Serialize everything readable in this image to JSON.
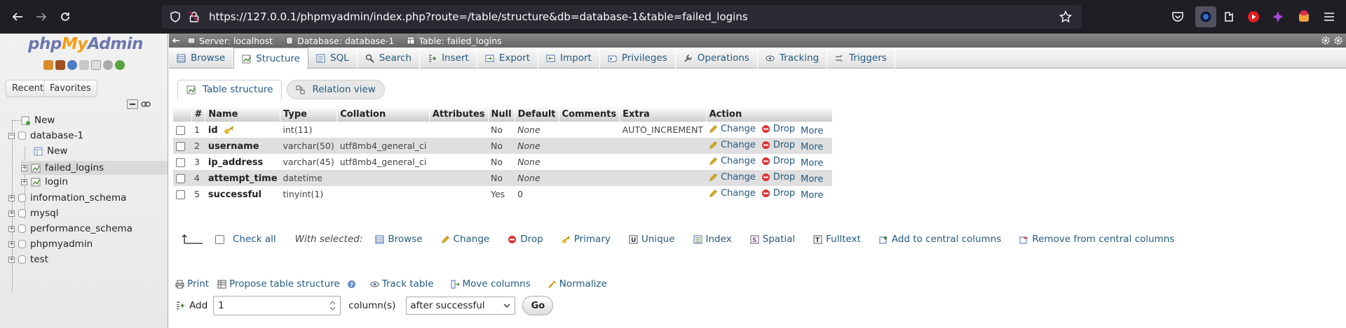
{
  "browser": {
    "url": "https://127.0.0.1/phpmyadmin/index.php?route=/table/structure&db=database-1&table=failed_logins"
  },
  "sidebar": {
    "logo": {
      "php": "php",
      "my": "My",
      "admin": "Admin"
    },
    "tabs": {
      "recent": "Recent",
      "favorites": "Favorites"
    },
    "tree": {
      "new_root": "New",
      "db1": "database-1",
      "new_db1": "New",
      "failed_logins": "failed_logins",
      "login": "login",
      "information_schema": "information_schema",
      "mysql": "mysql",
      "performance_schema": "performance_schema",
      "phpmyadmin": "phpmyadmin",
      "test": "test"
    }
  },
  "breadcrumb": {
    "server": "Server: localhost",
    "database": "Database: database-1",
    "table": "Table: failed_logins"
  },
  "tabs": [
    "Browse",
    "Structure",
    "SQL",
    "Search",
    "Insert",
    "Export",
    "Import",
    "Privileges",
    "Operations",
    "Tracking",
    "Triggers"
  ],
  "subtabs": {
    "table_structure": "Table structure",
    "relation_view": "Relation view"
  },
  "table": {
    "headers": {
      "num": "#",
      "name": "Name",
      "type": "Type",
      "collation": "Collation",
      "attributes": "Attributes",
      "null": "Null",
      "default": "Default",
      "comments": "Comments",
      "extra": "Extra",
      "action": "Action"
    },
    "rows": [
      {
        "num": "1",
        "name": "id",
        "type": "int(11)",
        "collation": "",
        "attributes": "",
        "null": "No",
        "default": "None",
        "comments": "",
        "extra": "AUTO_INCREMENT"
      },
      {
        "num": "2",
        "name": "username",
        "type": "varchar(50)",
        "collation": "utf8mb4_general_ci",
        "attributes": "",
        "null": "No",
        "default": "None",
        "comments": "",
        "extra": ""
      },
      {
        "num": "3",
        "name": "ip_address",
        "type": "varchar(45)",
        "collation": "utf8mb4_general_ci",
        "attributes": "",
        "null": "No",
        "default": "None",
        "comments": "",
        "extra": ""
      },
      {
        "num": "4",
        "name": "attempt_time",
        "type": "datetime",
        "collation": "",
        "attributes": "",
        "null": "No",
        "default": "None",
        "comments": "",
        "extra": ""
      },
      {
        "num": "5",
        "name": "successful",
        "type": "tinyint(1)",
        "collation": "",
        "attributes": "",
        "null": "Yes",
        "default": "0",
        "comments": "",
        "extra": ""
      }
    ],
    "actions": {
      "change": "Change",
      "drop": "Drop",
      "more": "More"
    }
  },
  "bulk": {
    "check_all": "Check all",
    "with_selected": "With selected:",
    "browse": "Browse",
    "change": "Change",
    "drop": "Drop",
    "primary": "Primary",
    "unique": "Unique",
    "index": "Index",
    "spatial": "Spatial",
    "fulltext": "Fulltext",
    "add_central": "Add to central columns",
    "remove_central": "Remove from central columns"
  },
  "bottom": {
    "print": "Print",
    "propose": "Propose table structure",
    "track": "Track table",
    "move": "Move columns",
    "normalize": "Normalize",
    "add_label": "Add",
    "add_value": "1",
    "columns_label": "column(s)",
    "position": "after successful",
    "go": "Go"
  },
  "colors": {
    "link": "#235a81",
    "accent": "#6c78af",
    "browser_bg": "#1f1e25"
  }
}
